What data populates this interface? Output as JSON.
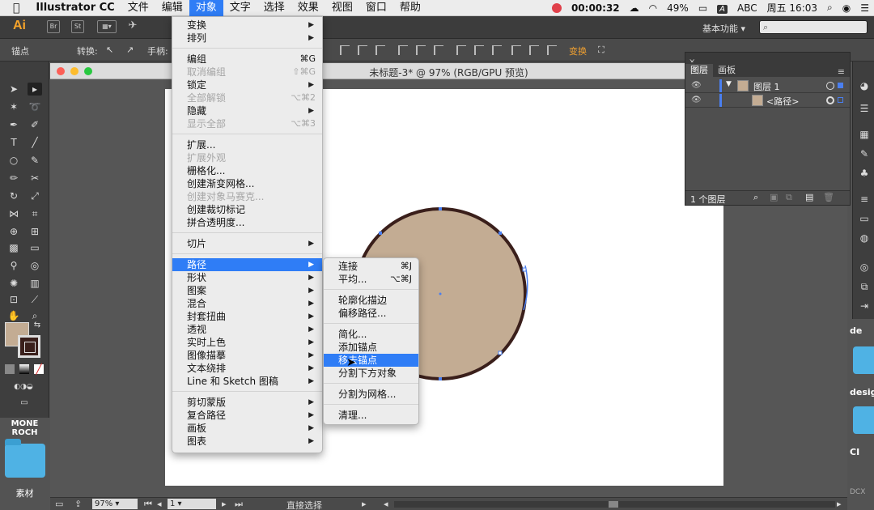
{
  "menubar": {
    "apple": "",
    "app": "Illustrator CC",
    "items": [
      "文件",
      "编辑",
      "对象",
      "文字",
      "选择",
      "效果",
      "视图",
      "窗口",
      "帮助"
    ],
    "active_index": 2,
    "timer": "00:00:32",
    "battery": "49%",
    "input_key": "A",
    "input_label": "ABC",
    "clock": "周五 16:03"
  },
  "appbar": {
    "logo": "Ai",
    "workspace": "基本功能",
    "search_placeholder": ""
  },
  "ctrlbar": {
    "anchor_label": "锚点",
    "convert_label": "转换:",
    "handle_label": "手柄:",
    "transform_label": "变换"
  },
  "document": {
    "title": "未标题-3* @ 97% (RGB/GPU 预览)",
    "zoom": "97%",
    "page": "1",
    "tool_name": "直接选择"
  },
  "colors": {
    "fill": "#c3ac93",
    "stroke": "#3a1f1b",
    "accent": "#2f7df6"
  },
  "layers_panel": {
    "tabs": [
      "图层",
      "画板"
    ],
    "layer_name": "图层 1",
    "sublayer_name": "<路径>",
    "footer": "1 个图层"
  },
  "desktop": {
    "left_label": "MONE ROCH",
    "folder_label": "素材",
    "right_labels": [
      "de",
      "desig",
      "CI",
      "DCX"
    ]
  },
  "object_menu": [
    {
      "label": "变换",
      "arrow": true
    },
    {
      "label": "排列",
      "arrow": true
    },
    {
      "sep": true
    },
    {
      "label": "编组",
      "shortcut": "⌘G"
    },
    {
      "label": "取消编组",
      "shortcut": "⇧⌘G",
      "disabled": true
    },
    {
      "label": "锁定",
      "arrow": true
    },
    {
      "label": "全部解锁",
      "shortcut": "⌥⌘2",
      "disabled": true
    },
    {
      "label": "隐藏",
      "arrow": true
    },
    {
      "label": "显示全部",
      "shortcut": "⌥⌘3",
      "disabled": true
    },
    {
      "sep": true
    },
    {
      "label": "扩展..."
    },
    {
      "label": "扩展外观",
      "disabled": true
    },
    {
      "label": "栅格化..."
    },
    {
      "label": "创建渐变网格..."
    },
    {
      "label": "创建对象马赛克...",
      "disabled": true
    },
    {
      "label": "创建裁切标记"
    },
    {
      "label": "拼合透明度..."
    },
    {
      "sep": true
    },
    {
      "label": "切片",
      "arrow": true
    },
    {
      "sep": true
    },
    {
      "label": "路径",
      "arrow": true,
      "highlight": true
    },
    {
      "label": "形状",
      "arrow": true
    },
    {
      "label": "图案",
      "arrow": true
    },
    {
      "label": "混合",
      "arrow": true
    },
    {
      "label": "封套扭曲",
      "arrow": true
    },
    {
      "label": "透视",
      "arrow": true
    },
    {
      "label": "实时上色",
      "arrow": true
    },
    {
      "label": "图像描摹",
      "arrow": true
    },
    {
      "label": "文本绕排",
      "arrow": true
    },
    {
      "label": "Line 和 Sketch 图稿",
      "arrow": true
    },
    {
      "sep": true
    },
    {
      "label": "剪切蒙版",
      "arrow": true
    },
    {
      "label": "复合路径",
      "arrow": true
    },
    {
      "label": "画板",
      "arrow": true
    },
    {
      "label": "图表",
      "arrow": true
    }
  ],
  "path_submenu": [
    {
      "label": "连接",
      "shortcut": "⌘J"
    },
    {
      "label": "平均...",
      "shortcut": "⌥⌘J"
    },
    {
      "sep": true
    },
    {
      "label": "轮廓化描边"
    },
    {
      "label": "偏移路径..."
    },
    {
      "sep": true
    },
    {
      "label": "简化..."
    },
    {
      "label": "添加锚点"
    },
    {
      "label": "移去锚点",
      "highlight": true
    },
    {
      "label": "分割下方对象"
    },
    {
      "sep": true
    },
    {
      "label": "分割为网格..."
    },
    {
      "sep": true
    },
    {
      "label": "清理..."
    }
  ]
}
